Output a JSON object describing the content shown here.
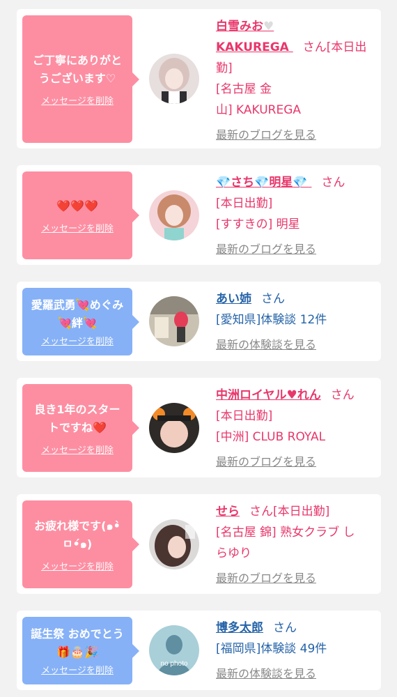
{
  "colors": {
    "pink_bubble": "#fd8ea2",
    "blue_bubble": "#86b1f7",
    "pink_text": "#e8376b",
    "blue_text": "#2563a8"
  },
  "items": [
    {
      "bubble_color": "pink",
      "message_line1": "ご丁寧にありがと",
      "message_line2": "うございます♡",
      "delete_label": "メッセージを削除",
      "name_part1": "白雪みお",
      "name_icon": "white-heart-icon",
      "name_part2": "KAKUREGA",
      "san": "さん",
      "status": "[本日出勤]",
      "shop_line1": "[名古屋 金",
      "shop_line2": "山] KAKUREGA",
      "link": "最新のブログを見る"
    },
    {
      "bubble_color": "pink",
      "message": "❤️❤️❤️",
      "delete_label": "メッセージを削除",
      "name_gem": "💎",
      "name_part1": "さち",
      "name_part2": "明星",
      "san": "さん",
      "status": "[本日出勤]",
      "shop": "[すすきの] 明星",
      "link": "最新のブログを見る"
    },
    {
      "bubble_color": "blue",
      "message_line1": "愛羅武勇💘めぐみ",
      "message_line2": "💘絆💘",
      "delete_label": "メッセージを削除",
      "name": "あい姉",
      "san": "さん",
      "detail": "[愛知県]体験談 12件",
      "link": "最新の体験談を見る"
    },
    {
      "bubble_color": "pink",
      "message_line1": "良き1年のスター",
      "message_line2": "トですね❤️",
      "delete_label": "メッセージを削除",
      "name": "中洲ロイヤル♥れん",
      "san": "さん",
      "status": "[本日出勤]",
      "shop": "[中洲] CLUB ROYAL",
      "link": "最新のブログを見る"
    },
    {
      "bubble_color": "pink",
      "message_line1": "お疲れ様です(๑•̀",
      "message_line2": "ㅁ•́๑)",
      "delete_label": "メッセージを削除",
      "name": "せら",
      "san": "さん",
      "status": "[本日出勤]",
      "shop_line1": "[名古屋 錦] 熟女クラブ し",
      "shop_line2": "らゆり",
      "link": "最新のブログを見る"
    },
    {
      "bubble_color": "blue",
      "message_line1": "誕生祭 おめでとう",
      "message_line2": "🎁🎂🎉",
      "delete_label": "メッセージを削除",
      "avatar_text": "no photo",
      "name": "博多太郎",
      "san": "さん",
      "detail": "[福岡県]体験談 49件",
      "link": "最新の体験談を見る"
    }
  ]
}
